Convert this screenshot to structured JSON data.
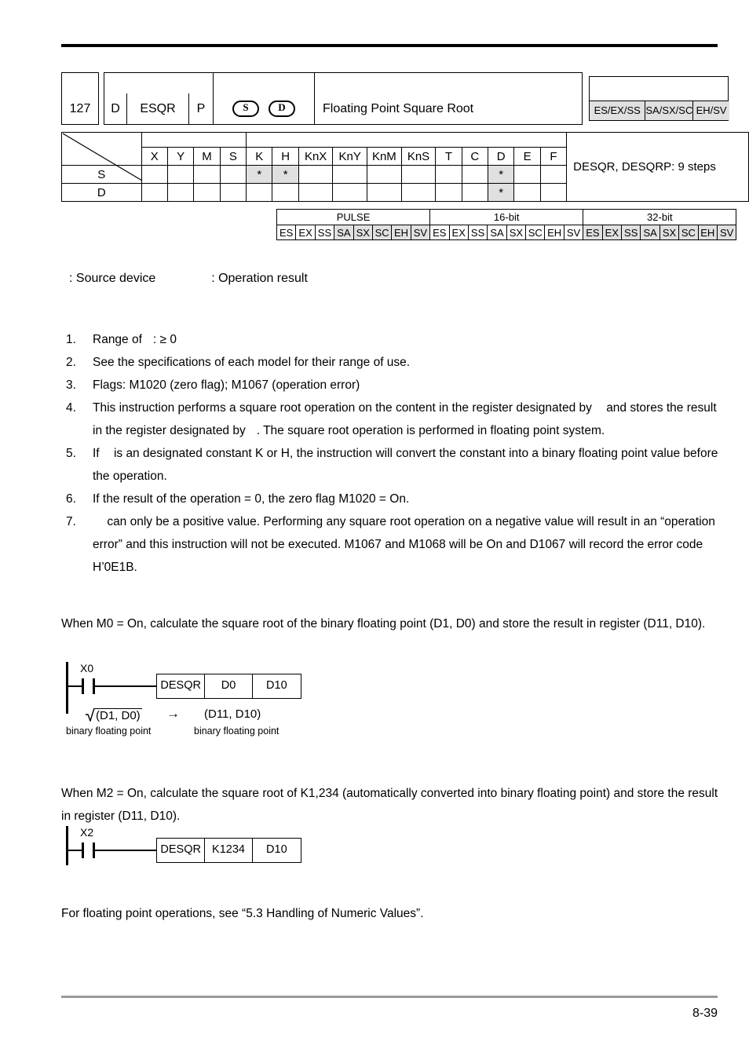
{
  "header": {
    "api_number": "127",
    "d_flag": "D",
    "mnemonic": "ESQR",
    "p_flag": "P",
    "operand_s": "S",
    "operand_d": "D",
    "description": "Floating Point Square Root",
    "models": [
      "ES/EX/SS",
      "SA/SX/SC",
      "EH/SV"
    ]
  },
  "operand_table": {
    "columns": [
      "X",
      "Y",
      "M",
      "S",
      "K",
      "H",
      "KnX",
      "KnY",
      "KnM",
      "KnS",
      "T",
      "C",
      "D",
      "E",
      "F"
    ],
    "steps": "DESQR, DESQRP: 9 steps",
    "rows": [
      {
        "label": "S",
        "marks": [
          "",
          "",
          "",
          "",
          "*",
          "*",
          "",
          "",
          "",
          "",
          "",
          "",
          "*",
          "",
          ""
        ]
      },
      {
        "label": "D",
        "marks": [
          "",
          "",
          "",
          "",
          "",
          "",
          "",
          "",
          "",
          "",
          "",
          "",
          "*",
          "",
          ""
        ]
      }
    ]
  },
  "bit_table": {
    "groups": [
      {
        "title": "PULSE",
        "cells": [
          "ES",
          "EX",
          "SS",
          "SA",
          "SX",
          "SC",
          "EH",
          "SV"
        ],
        "shaded": [
          false,
          false,
          false,
          true,
          true,
          true,
          true,
          true
        ]
      },
      {
        "title": "16-bit",
        "cells": [
          "ES",
          "EX",
          "SS",
          "SA",
          "SX",
          "SC",
          "EH",
          "SV"
        ],
        "shaded": [
          false,
          false,
          false,
          false,
          false,
          false,
          false,
          false
        ]
      },
      {
        "title": "32-bit",
        "cells": [
          "ES",
          "EX",
          "SS",
          "SA",
          "SX",
          "SC",
          "EH",
          "SV"
        ],
        "shaded": [
          true,
          true,
          true,
          true,
          true,
          true,
          true,
          true
        ]
      }
    ]
  },
  "legend": {
    "source_label": ": Source device",
    "result_label": ": Operation result"
  },
  "notes": [
    {
      "num": "1.",
      "text": ": ≥ 0",
      "prefix": "Range of"
    },
    {
      "num": "2.",
      "text": "See the specifications of each model for their range of use."
    },
    {
      "num": "3.",
      "text": "Flags: M1020 (zero flag); M1067 (operation error)"
    },
    {
      "num": "4.",
      "text": "This instruction performs a square root operation on the content in the register designated by"
    },
    {
      "num": "5.",
      "text": "is an designated constant K or H, the instruction will convert the constant into a binary floating point value before the operation.",
      "prefix": "If"
    },
    {
      "num": "6.",
      "text": "If the result of the operation = 0, the zero flag M1020 = On."
    },
    {
      "num": "7.",
      "text": "can only be a positive value. Performing any square root operation on a negative value will result in an “operation error” and this instruction will not be executed. M1067 and M1068 will be On and D1067 will record the error code H’0E1B."
    }
  ],
  "note4_continuation": {
    "before": "and stores the result in the register designated by",
    "after": ". The square root operation is performed in floating point system."
  },
  "example1": {
    "intro": "When M0 = On, calculate the square root of the binary floating point (D1, D0) and store the result in register (D11, D10).",
    "contact": "X0",
    "instruction": "DESQR",
    "operand1": "D0",
    "operand2": "D10",
    "radicand": "(D1, D0)",
    "arrow": "→",
    "result": "(D11, D10)",
    "note_left": "binary floating point",
    "note_right": "binary floating point"
  },
  "example2": {
    "intro": "When M2 = On, calculate the square root of K1,234 (automatically converted into binary floating point) and store the result in register (D11, D10).",
    "contact": "X2",
    "instruction": "DESQR",
    "operand1": "K1234",
    "operand2": "D10"
  },
  "footer": {
    "reference_note": "For floating point operations, see “5.3 Handling of Numeric Values”.",
    "page_number": "8-39"
  },
  "colors": {
    "shade": "#e0e0e0",
    "rule": "#000000",
    "footer_rule": "#999999"
  }
}
